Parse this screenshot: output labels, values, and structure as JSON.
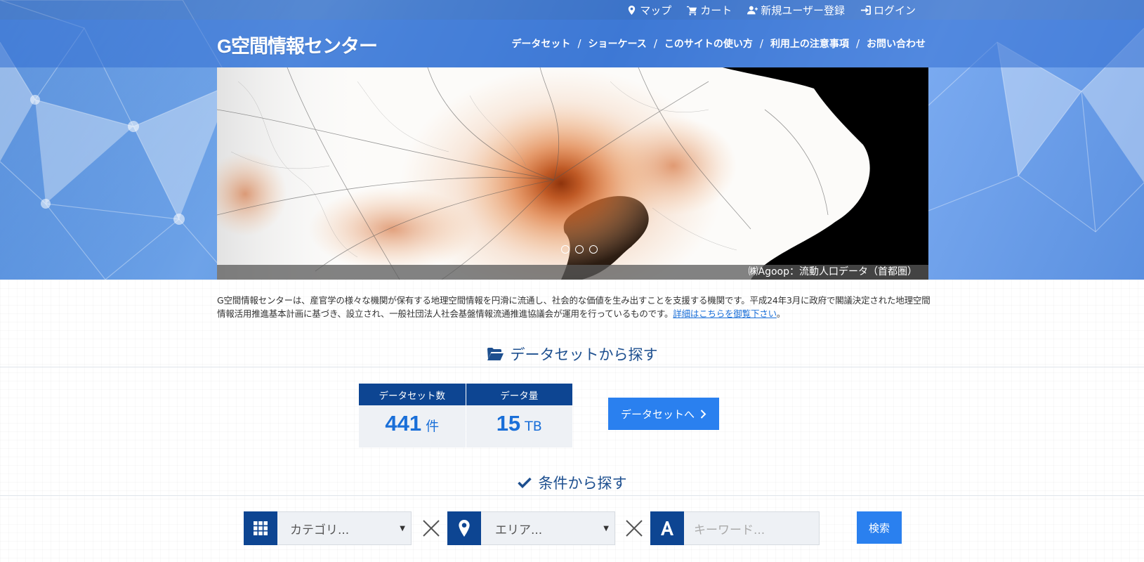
{
  "topbar": {
    "links": [
      {
        "label": "マップ",
        "icon": "map-marker-icon"
      },
      {
        "label": "カート",
        "icon": "cart-icon"
      },
      {
        "label": "新規ユーザー登録",
        "icon": "user-plus-icon"
      },
      {
        "label": "ログイン",
        "icon": "sign-in-icon"
      }
    ]
  },
  "header": {
    "logo": "G空間情報センター",
    "nav": [
      "データセット",
      "ショーケース",
      "このサイトの使い方",
      "利用上の注意事項",
      "お問い合わせ"
    ],
    "separator": "/"
  },
  "carousel": {
    "caption": "㈱Agoop：流動人口データ（首都圏）",
    "dot_count": 3,
    "active_dot": 0
  },
  "intro": {
    "text": "G空間情報センターは、産官学の様々な機関が保有する地理空間情報を円滑に流通し、社会的な価値を生み出すことを支援する機関です。平成24年3月に政府で閣議決定された地理空間情報活用推進基本計画に基づき、設立され、一般社団法人社会基盤情報流通推進協議会が運用を行っているものです。",
    "link": "詳細はこちらを御覧下さい",
    "end": "。"
  },
  "dataset_section": {
    "title": "データセットから探す",
    "icon": "folder-open-icon",
    "stats": [
      {
        "label": "データセット数",
        "value": "441",
        "unit": "件"
      },
      {
        "label": "データ量",
        "value": "15",
        "unit": "TB"
      }
    ],
    "button": "データセットへ",
    "button_icon": "chevron-right-icon"
  },
  "condition_section": {
    "title": "条件から探す",
    "icon": "check-icon",
    "category_placeholder": "カテゴリ...",
    "area_placeholder": "エリア...",
    "keyword_placeholder": "キーワード...",
    "search_button": "検索"
  },
  "colors": {
    "navy": "#0d4592",
    "accent": "#2a80ef",
    "heading": "#1d4f8f"
  }
}
